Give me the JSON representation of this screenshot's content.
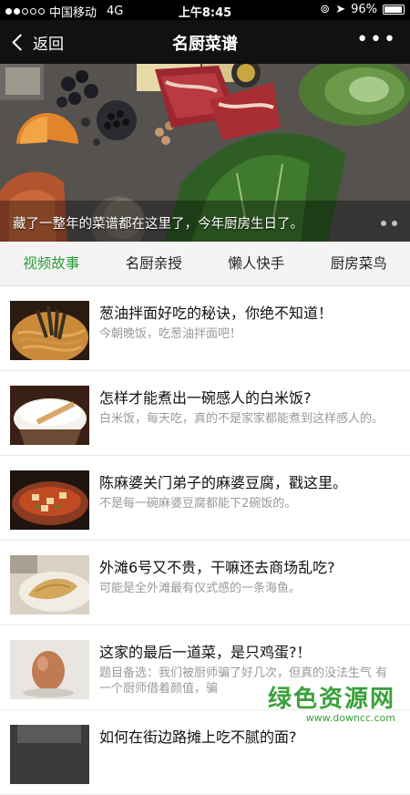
{
  "status_bar": {
    "carrier": "中国移动",
    "network": "4G",
    "time": "上午8:45",
    "battery": "96%",
    "battery_level": 0.96
  },
  "nav": {
    "back_label": "返回",
    "title": "名厨菜谱",
    "more_icon": "more-dots-icon"
  },
  "banner": {
    "caption": "藏了一整年的菜谱都在这里了，今年厨房生日了。"
  },
  "tabs": [
    {
      "label": "视频故事",
      "active": true
    },
    {
      "label": "名厨亲授",
      "active": false
    },
    {
      "label": "懒人快手",
      "active": false
    },
    {
      "label": "厨房菜鸟",
      "active": false
    }
  ],
  "accent_color": "#2a9d3a",
  "articles": [
    {
      "title": "葱油拌面好吃的秘诀，你绝不知道！",
      "subtitle": "今朝晚饭，吃葱油拌面吧！"
    },
    {
      "title": "怎样才能煮出一碗感人的白米饭?",
      "subtitle": "白米饭，每天吃，真的不是家家都能煮到这样感人的。"
    },
    {
      "title": "陈麻婆关门弟子的麻婆豆腐，戳这里。",
      "subtitle": "不是每一碗麻婆豆腐都能下2碗饭的。"
    },
    {
      "title": "外滩6号又不贵，干嘛还去商场乱吃?",
      "subtitle": "可能是全外滩最有仪式感的一条海鱼。"
    },
    {
      "title": "这家的最后一道菜，是只鸡蛋?！",
      "subtitle": "题目备选：我们被厨师骗了好几次，但真的没法生气 有一个厨师借着颜值，骗"
    },
    {
      "title": "如何在街边路摊上吃不腻的面?",
      "subtitle": ""
    }
  ],
  "watermark": {
    "text": "绿色资源网",
    "url": "www.downcc.com"
  }
}
